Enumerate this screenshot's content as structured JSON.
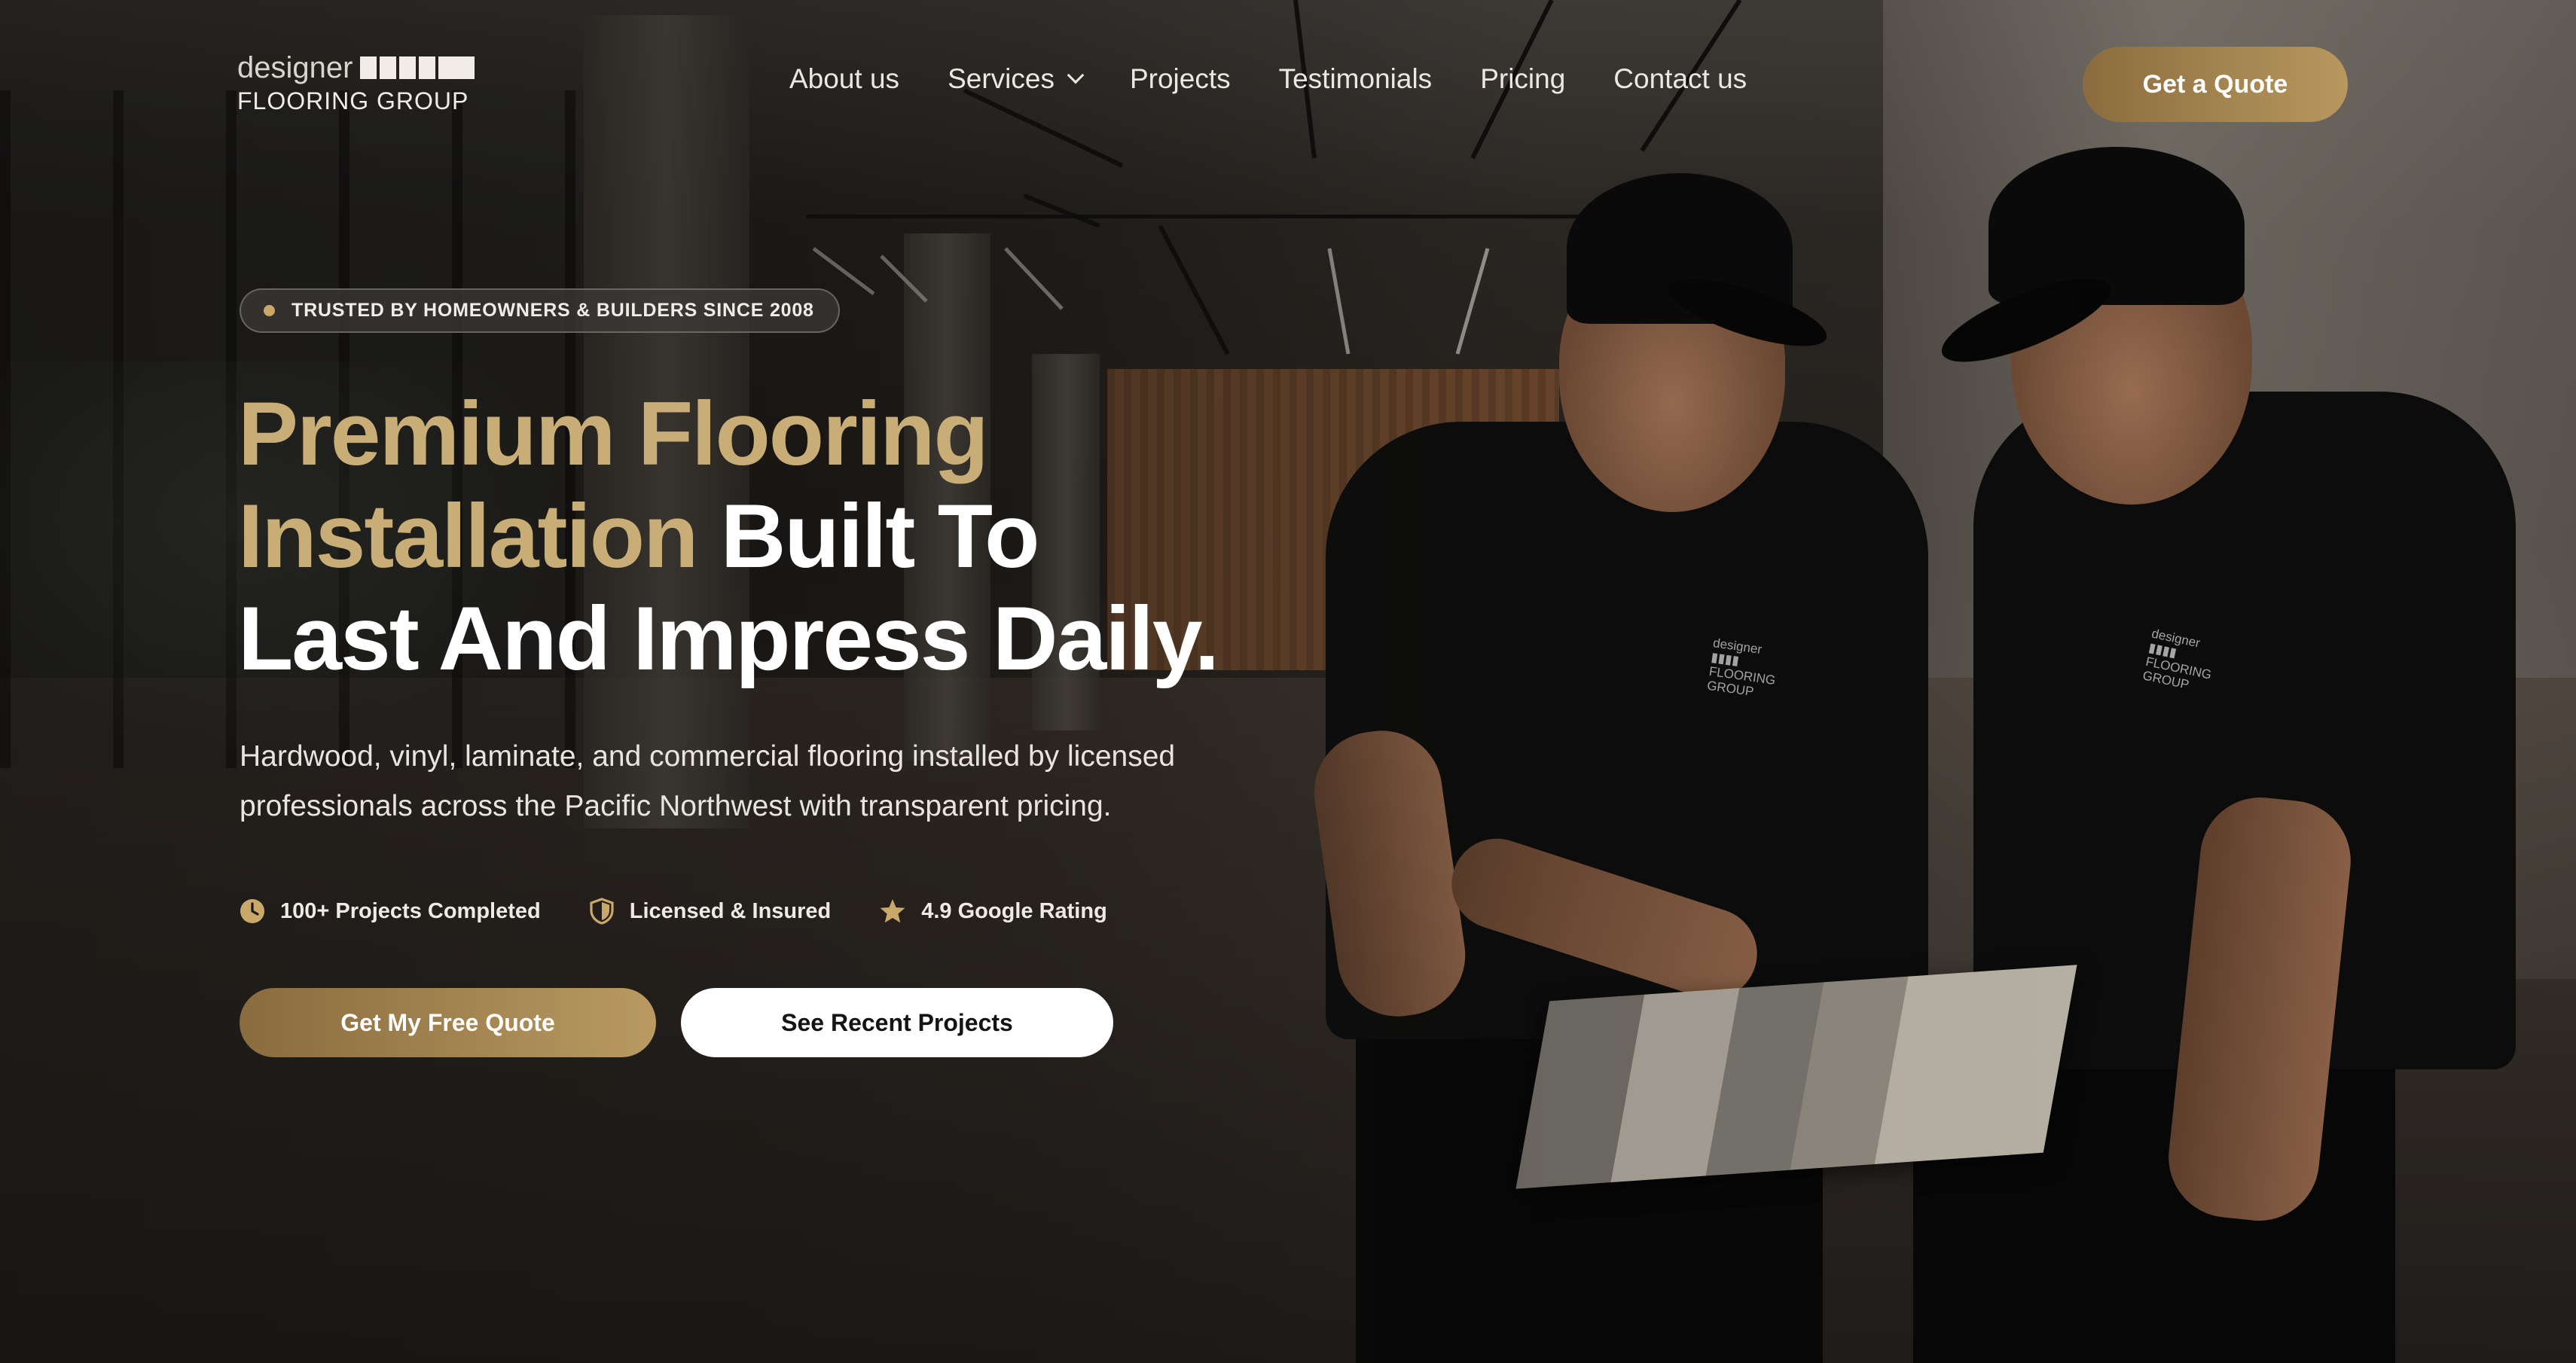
{
  "brand": {
    "logo_top": "designer",
    "logo_bottom": "FLOORING GROUP",
    "accent_color": "#c9ad76",
    "button_gradient": [
      "#8a6b3f",
      "#b99a60"
    ]
  },
  "nav": {
    "items": [
      {
        "label": "About us"
      },
      {
        "label": "Services",
        "icon": "chevron-down-icon"
      },
      {
        "label": "Projects"
      },
      {
        "label": "Testimonials"
      },
      {
        "label": "Pricing"
      },
      {
        "label": "Contact us"
      }
    ],
    "cta_label": "Get a Quote"
  },
  "hero": {
    "badge": "TRUSTED BY HOMEOWNERS & BUILDERS SINCE 2008",
    "headline": {
      "line1": "Premium Flooring",
      "line2_accent": "Installation",
      "line2_rest": " Built To",
      "line3": "Last And Impress Daily."
    },
    "subhead": "Hardwood, vinyl, laminate, and commercial flooring installed by licensed professionals across the Pacific Northwest with transparent pricing.",
    "features": [
      {
        "icon": "clock-icon",
        "label": "100+ Projects Completed"
      },
      {
        "icon": "shield-icon",
        "label": "Licensed & Insured"
      },
      {
        "icon": "star-icon",
        "label": "4.9 Google Rating"
      }
    ],
    "primary_cta": "Get My Free Quote",
    "secondary_cta": "See Recent Projects"
  }
}
